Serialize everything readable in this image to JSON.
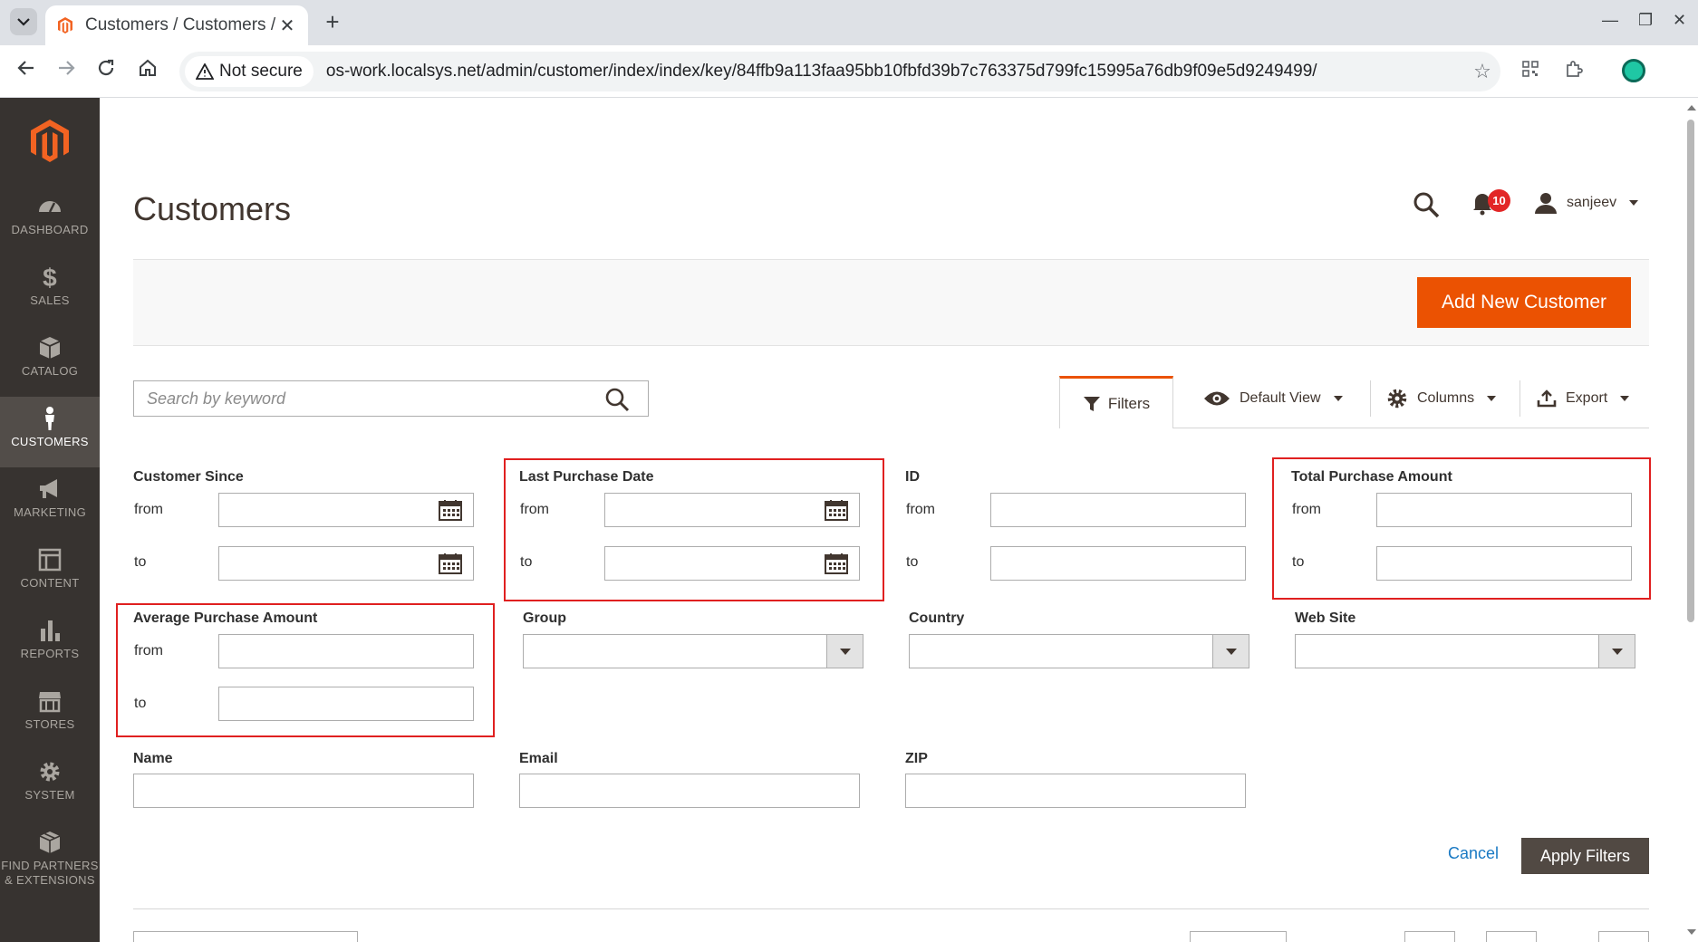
{
  "browser": {
    "tab_title": "Customers / Customers /",
    "security_label": "Not secure",
    "url": "os-work.localsys.net/admin/customer/index/index/key/84ffb9a113faa95bb10fbfd39b7c763375d799fc15995a76db9f09e5d9249499/"
  },
  "sidebar": {
    "items": [
      {
        "label": "DASHBOARD",
        "icon": "dashboard-icon"
      },
      {
        "label": "SALES",
        "icon": "dollar-icon"
      },
      {
        "label": "CATALOG",
        "icon": "box-icon"
      },
      {
        "label": "CUSTOMERS",
        "icon": "person-icon"
      },
      {
        "label": "MARKETING",
        "icon": "megaphone-icon"
      },
      {
        "label": "CONTENT",
        "icon": "layout-icon"
      },
      {
        "label": "REPORTS",
        "icon": "bar-chart-icon"
      },
      {
        "label": "STORES",
        "icon": "store-icon"
      },
      {
        "label": "SYSTEM",
        "icon": "gear-icon"
      }
    ],
    "partners_line1": "FIND PARTNERS",
    "partners_line2": "& EXTENSIONS"
  },
  "header": {
    "title": "Customers",
    "notification_count": "10",
    "user": "sanjeev"
  },
  "actions": {
    "add_new": "Add New Customer"
  },
  "toolbar": {
    "search_placeholder": "Search by keyword",
    "filters": "Filters",
    "default_view": "Default View",
    "columns": "Columns",
    "export": "Export"
  },
  "filters": {
    "from": "from",
    "to": "to",
    "customer_since": "Customer Since",
    "last_purchase_date": "Last Purchase Date",
    "id": "ID",
    "total_purchase_amount": "Total Purchase Amount",
    "average_purchase_amount": "Average Purchase Amount",
    "group": "Group",
    "country": "Country",
    "web_site": "Web Site",
    "name": "Name",
    "email": "Email",
    "zip": "ZIP",
    "cancel": "Cancel",
    "apply": "Apply Filters"
  },
  "colors": {
    "accent": "#eb5202",
    "sidebar_bg": "#373330",
    "highlight": "#e02020"
  }
}
